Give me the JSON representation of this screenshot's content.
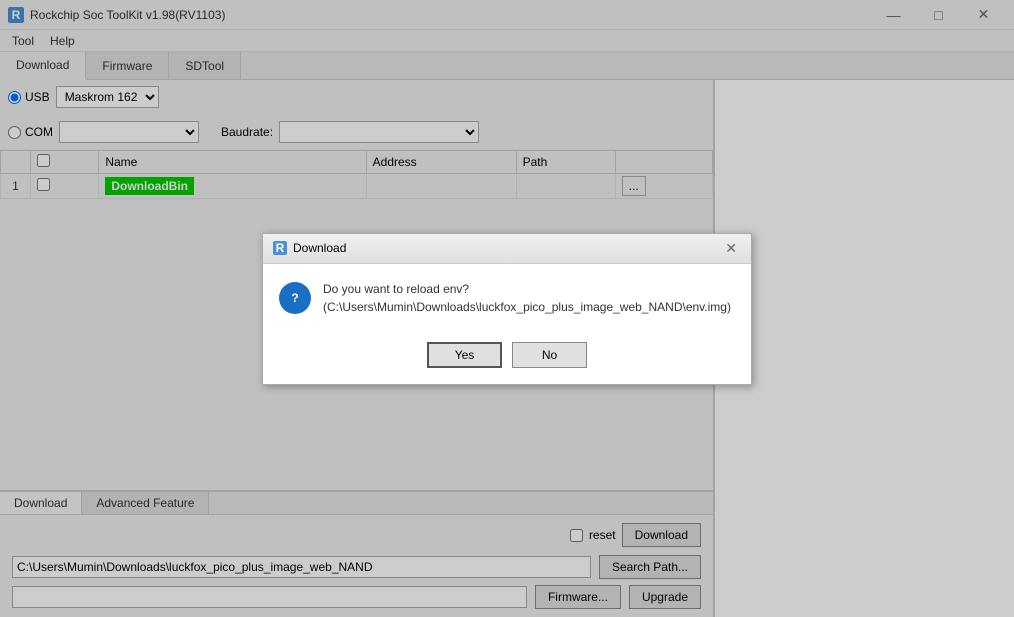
{
  "titleBar": {
    "icon": "R",
    "title": "Rockchip Soc ToolKit v1.98(RV1103)",
    "minimizeBtn": "—",
    "maximizeBtn": "□",
    "closeBtn": "✕"
  },
  "menuBar": {
    "items": [
      "Tool",
      "Help"
    ]
  },
  "tabs": [
    {
      "label": "Download",
      "active": true
    },
    {
      "label": "Firmware",
      "active": false
    },
    {
      "label": "SDTool",
      "active": false
    }
  ],
  "connectionPanel": {
    "usbLabel": "USB",
    "comLabel": "COM",
    "usbSelected": true,
    "usbOption": "Maskrom  162",
    "baudrateLabel": "Baudrate:",
    "baudrateValue": ""
  },
  "table": {
    "columns": [
      "",
      "Name",
      "Address",
      "Path",
      ""
    ],
    "rows": [
      {
        "num": "1",
        "checked": false,
        "name": "DownloadBin",
        "address": "",
        "path": "",
        "browse": "..."
      }
    ]
  },
  "bottomTabs": [
    {
      "label": "Download",
      "active": true
    },
    {
      "label": "Advanced Feature",
      "active": false
    }
  ],
  "bottomControls": {
    "resetLabel": "reset",
    "downloadBtn": "Download",
    "pathValue": "C:\\Users\\Mumin\\Downloads\\luckfox_pico_plus_image_web_NAND",
    "searchPathBtn": "Search Path...",
    "firmwareInput": "",
    "firmwareBtn": "Firmware...",
    "upgradeBtn": "Upgrade"
  },
  "dialog": {
    "title": "Download",
    "icon": "R",
    "questionIcon": "?",
    "message": "Do you want to reload env?(C:\\Users\\Mumin\\Downloads\\luckfox_pico_plus_image_web_NAND\\env.img)",
    "yesBtn": "Yes",
    "noBtn": "No"
  },
  "logArea": {
    "content": ""
  }
}
